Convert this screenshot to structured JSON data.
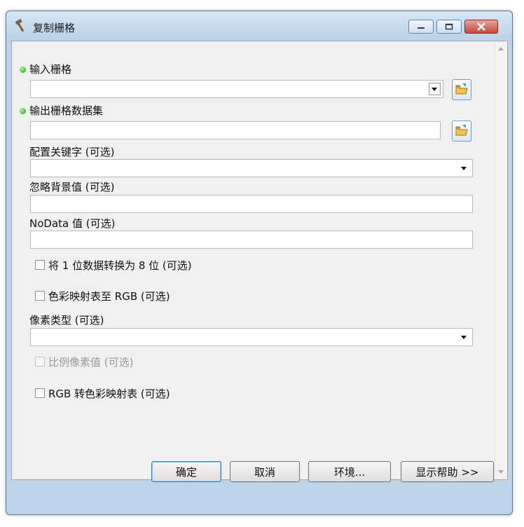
{
  "window": {
    "title": "复制栅格"
  },
  "params": {
    "input_raster": {
      "label": "输入栅格",
      "value": ""
    },
    "output_raster": {
      "label": "输出栅格数据集",
      "value": ""
    },
    "config_keyword": {
      "label": "配置关键字 (可选)",
      "value": ""
    },
    "ignore_background": {
      "label": "忽略背景值 (可选)",
      "value": ""
    },
    "nodata": {
      "label": "NoData 值 (可选)",
      "value": ""
    },
    "one_to_eight_bit": {
      "label": "将 1 位数据转换为 8 位 (可选)",
      "checked": false
    },
    "colormap_to_rgb": {
      "label": "色彩映射表至 RGB (可选)",
      "checked": false
    },
    "pixel_type": {
      "label": "像素类型 (可选)",
      "value": ""
    },
    "scale_pixel": {
      "label": "比例像素值 (可选)",
      "checked": false,
      "enabled": false
    },
    "rgb_to_colormap": {
      "label": "RGB 转色彩映射表 (可选)",
      "checked": false
    }
  },
  "buttons": {
    "ok": "确定",
    "cancel": "取消",
    "environments": "环境...",
    "show_help": "显示帮助 >>"
  },
  "colors": {
    "required_dot": "#1a9d12",
    "default_button_border": "#3c7fb1"
  }
}
